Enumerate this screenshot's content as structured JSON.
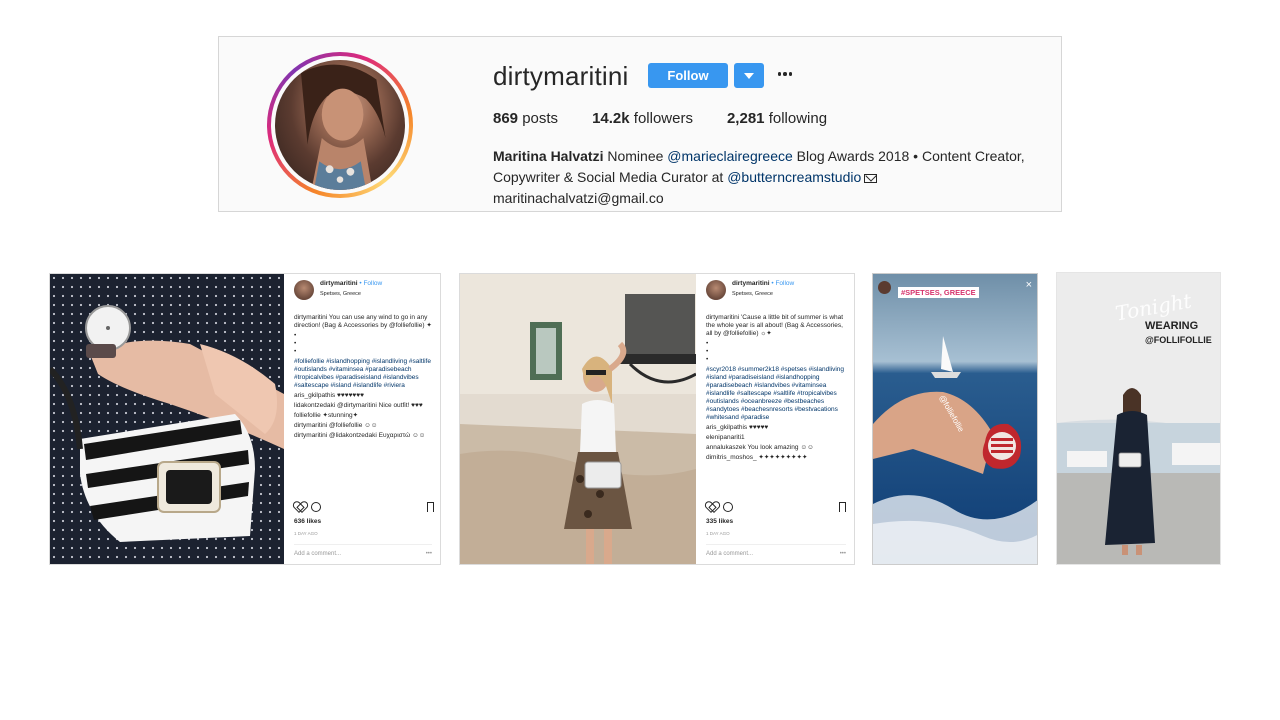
{
  "profile": {
    "username": "dirtymaritini",
    "follow_label": "Follow",
    "stats": {
      "posts_count": "869",
      "posts_label": "posts",
      "followers_count": "14.2k",
      "followers_label": "followers",
      "following_count": "2,281",
      "following_label": "following"
    },
    "bio": {
      "name": "Maritina Halvatzi",
      "text1": " Nominee ",
      "mention1": "@marieclairegreece",
      "text2": " Blog Awards 2018 • Content Creator, Copywriter & Social Media Curator at ",
      "mention2": "@butterncreamstudio",
      "email": "maritinachalvatzi@gmail.co"
    }
  },
  "posts": [
    {
      "username": "dirtymaritini",
      "follow": "• Follow",
      "location": "Spetses, Greece",
      "caption": "dirtymaritini You can use any wind to go in any direction! (Bag & Accessories by @folliefollie) ✦",
      "tags": "#folliefollie #islandhopping #islandliving #saltlife #outislands #vitaminsea #paradisebeach #tropicalvibes #paradiseisland #islandvibes #saltescape #island #islandlife #riviera",
      "comments": [
        "aris_gkilpathis ♥♥♥♥♥♥♥",
        "lidakontzedaki @dirtymaritini Nice outfit! ♥♥♥",
        "folliefollie ✦stunning✦",
        "dirtymaritini @folliefollie ☺☺",
        "dirtymaritini @lidakontzedaki Ευχαριστώ ☺☺"
      ],
      "likes": "636 likes",
      "ago": "1 DAY AGO",
      "add_comment": "Add a comment..."
    },
    {
      "username": "dirtymaritini",
      "follow": "• Follow",
      "location": "Spetses, Greece",
      "caption": "dirtymaritini 'Cause a little bit of summer is what the whole year is all about! (Bag & Accessories, all by @folliefollie) ☼✦",
      "tags": "#scyr2018 #summer2k18 #spetses #islandliving #island #paradiseisland #islandhopping #paradisebeach #islandvibes #vitaminsea #islandlife #saltescape #saltlife #tropicalvibes #outislands #oceanbreeze #bestbeaches #sandytoes #beachesnresorts #bestvacations #whitesand #paradise",
      "comments": [
        "aris_gkilpathis ♥♥♥♥♥",
        "elenipanariti1",
        "annalukaszek You look amazing ☺☺",
        "dimitris_moshos_ ✦✦✦✦✦✦✦✦✦"
      ],
      "likes": "335 likes",
      "ago": "1 DAY AGO",
      "add_comment": "Add a comment..."
    }
  ],
  "stories": [
    {
      "tag": "#SPETSES, GREECE",
      "watermark": "@folliefollie"
    },
    {
      "line1": "Tonight",
      "line2": "WEARING",
      "line3": "@FOLLIFOLLIE"
    }
  ],
  "colors": {
    "accent": "#3897f0",
    "mention": "#003569"
  }
}
